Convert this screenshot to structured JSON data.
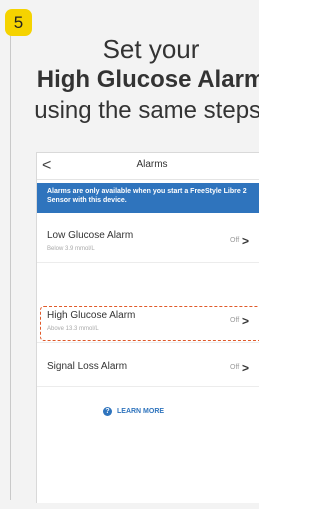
{
  "step": {
    "number": "5"
  },
  "headline": {
    "line1": "Set your",
    "line2": "High Glucose Alarm",
    "line3": "using the same steps",
    "footnote_mark": "‡"
  },
  "phone": {
    "nav": {
      "back_icon": "chevron-left-icon",
      "back_glyph": "<",
      "title": "Alarms"
    },
    "banner": {
      "text": "Alarms are only available when you start a FreeStyle Libre 2 Sensor with this device."
    },
    "alarms": [
      {
        "label": "Low Glucose Alarm",
        "sublabel": "Below 3.9 mmol/L",
        "status": "Off",
        "chevron": ">"
      },
      {
        "label": "High Glucose Alarm",
        "sublabel": "Above 13.3 mmol/L",
        "status": "Off",
        "chevron": ">"
      },
      {
        "label": "Signal Loss Alarm",
        "sublabel": "",
        "status": "Off",
        "chevron": ">"
      }
    ],
    "learn_more": {
      "icon": "help-circle-icon",
      "icon_glyph": "?",
      "label": "LEARN MORE"
    }
  },
  "colors": {
    "badge": "#f5d300",
    "banner": "#2f74bd",
    "highlight": "#e05a2a",
    "link": "#2f74bd"
  }
}
